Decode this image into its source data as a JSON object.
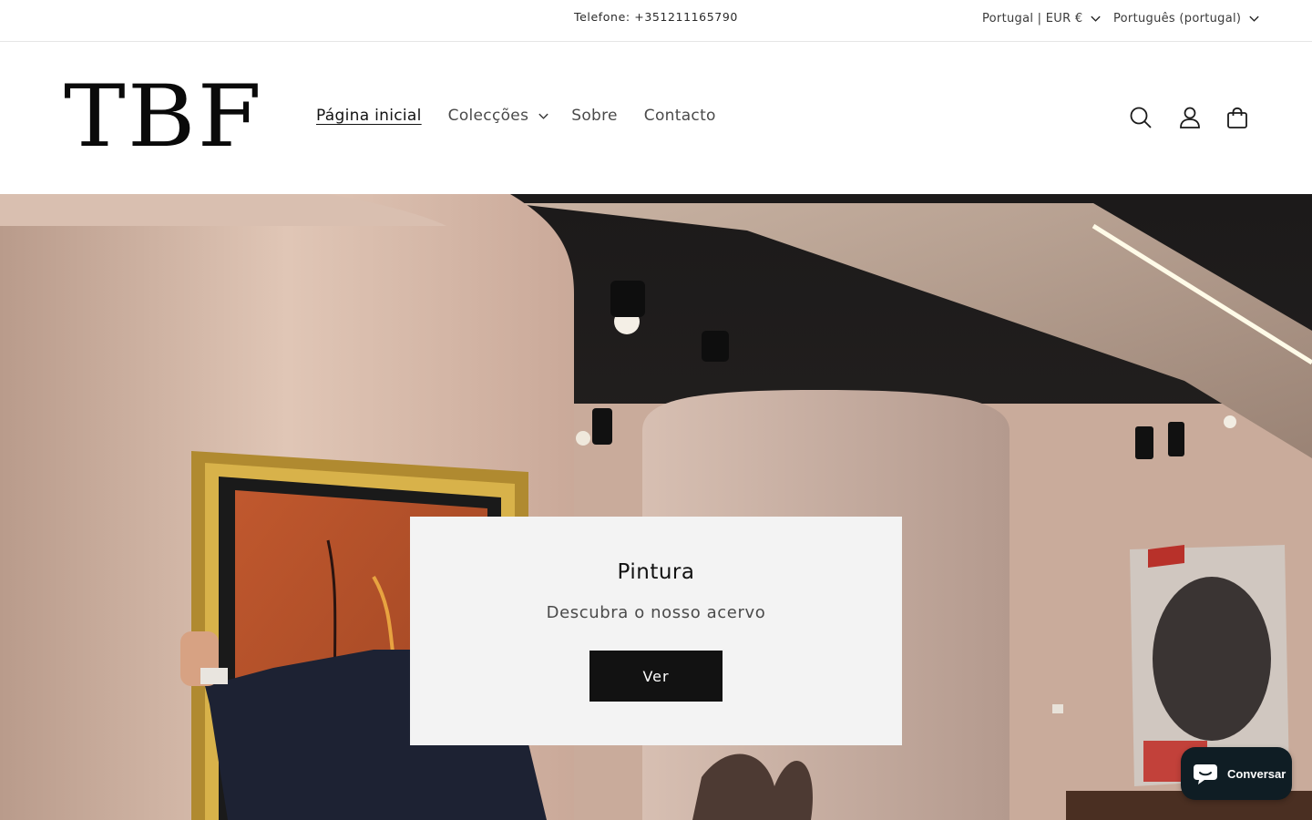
{
  "announcement": {
    "phone_text": "Telefone: +351211165790"
  },
  "localization": {
    "country": "Portugal | EUR €",
    "language": "Português (portugal)"
  },
  "header": {
    "logo_text": "TBF",
    "nav": [
      {
        "label": "Página inicial",
        "active": true
      },
      {
        "label": "Colecções",
        "has_dropdown": true
      },
      {
        "label": "Sobre"
      },
      {
        "label": "Contacto"
      }
    ],
    "icons": [
      "search-icon",
      "account-icon",
      "cart-icon"
    ]
  },
  "hero": {
    "title": "Pintura",
    "subtitle": "Descubra o nosso acervo",
    "button_label": "Ver"
  },
  "chat": {
    "label": "Conversar"
  },
  "colors": {
    "button_bg": "#121212",
    "chat_bg": "#0f1d24",
    "box_bg": "#f3f3f3"
  }
}
